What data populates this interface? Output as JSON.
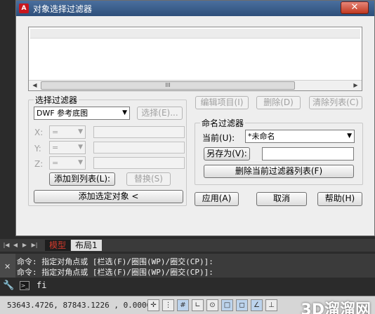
{
  "window": {
    "title": "对象选择过滤器",
    "app_icon_text": "A",
    "close_symbol": "✕"
  },
  "list": {
    "scroll_left": "◀",
    "scroll_right": "▶",
    "thumb_grip": "III"
  },
  "top_buttons": {
    "edit_item": "编辑项目(I)",
    "delete": "删除(D)",
    "clear_list": "清除列表(C)"
  },
  "select_filter": {
    "group_label": "选择过滤器",
    "type_value": "DWF 参考底图",
    "select_button": "选择(E)...",
    "x_label": "X:",
    "y_label": "Y:",
    "z_label": "Z:",
    "operator_value": "=",
    "add_to_list": "添加到列表(L):",
    "replace": "替换(S)",
    "add_selected": "添加选定对象 <"
  },
  "named_filters": {
    "group_label": "命名过滤器",
    "current_label": "当前(U):",
    "current_value": "*未命名",
    "save_as": "另存为(V):",
    "save_as_value": "",
    "delete_current": "删除当前过滤器列表(F)"
  },
  "dialog_buttons": {
    "apply": "应用(A)",
    "cancel": "取消",
    "help": "帮助(H)"
  },
  "layout_tabs": {
    "nav": [
      "|◀",
      "◀",
      "▶",
      "▶|"
    ],
    "model": "模型",
    "layout1": "布局1"
  },
  "command": {
    "history": [
      "命令: 指定对角点或 [栏选(F)/圈围(WP)/圈交(CP)]:",
      "命令: 指定对角点或 [栏选(F)/圈围(WP)/圈交(CP)]:"
    ],
    "close_symbol": "✕",
    "input": "fi",
    "wrench_icon": "wrench-icon"
  },
  "status_bar": {
    "coordinates": "53643.4726, 87843.1226 , 0.0000",
    "icons": [
      "snap-icon",
      "grid-icon",
      "ortho-icon",
      "polar-icon",
      "osnap-icon",
      "otrack-icon",
      "ducs-icon",
      "dyn-icon",
      "lineweight-icon"
    ],
    "watermark": "3D溜溜网"
  }
}
